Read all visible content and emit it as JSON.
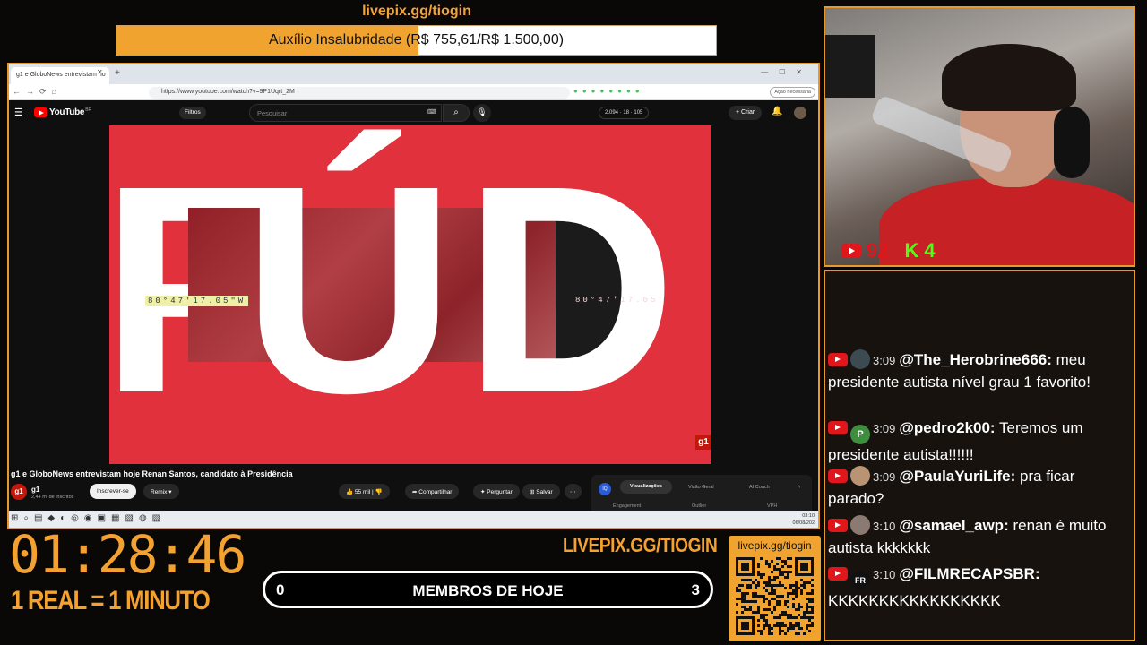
{
  "goal": {
    "url": "livepix.gg/tiogin",
    "text": "Auxílio Insalubridade (R$ 755,61/R$ 1.500,00)",
    "progress": 0.5037
  },
  "browser": {
    "tab_title": "g1 e GloboNews entrevistam ho",
    "url": "https://www.youtube.com/watch?v=9P1Uqrt_2M",
    "ai_button": "Ação necessária"
  },
  "youtube": {
    "logo": "YouTube",
    "country": "BR",
    "filters_label": "Filtros",
    "search_placeholder": "Pesquisar",
    "stats": "2.094 · 18 · 105",
    "create_label": "Criar",
    "video": {
      "letters": [
        "F",
        "Ú",
        "D"
      ],
      "coord_left": "80°47'17.05\"W",
      "coord_right": "80°47'17.05",
      "badge": "g1"
    },
    "title": "g1 e GloboNews entrevistam hoje Renan Santos, candidato à Presidência",
    "channel": {
      "avatar": "g1",
      "name": "g1",
      "subscribers": "2,44 mi de inscritos",
      "subscribe_label": "Inscrever-se",
      "remix_label": "Remix"
    },
    "actions": {
      "likes": "55 mil",
      "share": "Compartilhar",
      "ask": "Perguntar",
      "save": "Salvar"
    },
    "side_panel": {
      "logo": "IQ",
      "tabs": [
        "Visualizações",
        "Visão Geral",
        "AI Coach"
      ],
      "columns": [
        "Engagement",
        "Outlier",
        "VPH"
      ]
    }
  },
  "taskbar": {
    "time": "03:10",
    "date": "06/08/202"
  },
  "webcam": {
    "youtube_viewers": "92",
    "kick_icon": "K",
    "kick_viewers": "4"
  },
  "chat": [
    {
      "time": "3:09",
      "user": "@The_Herobrine666:",
      "text": "meu presidente autista nível grau 1 favorito!",
      "avatar": "",
      "avatar_color": "#3c4a52"
    },
    {
      "time": "3:09",
      "user": "@pedro2k00:",
      "text": "Teremos um presidente autista!!!!!!",
      "avatar": "P",
      "avatar_color": "#3f8d3e"
    },
    {
      "time": "3:09",
      "user": "@PaulaYuriLife:",
      "text": "pra ficar parado?",
      "avatar": "",
      "avatar_color": "#b89474"
    },
    {
      "time": "3:10",
      "user": "@samael_awp:",
      "text": "renan é muito autista kkkkkkk",
      "avatar": "",
      "avatar_color": "#8a7a72"
    },
    {
      "time": "3:10",
      "user": "@FILMRECAPSBR:",
      "text": "KKKKKKKKKKKKKKKKK",
      "avatar": "FR",
      "avatar_color": "#111111"
    }
  ],
  "overlay": {
    "timer": "01:28:46",
    "rate": "1 REAL = 1 MINUTO",
    "livepix_big": "LIVEPIX.GG/TIOGIN",
    "members_left": "0",
    "members_label": "MEMBROS DE HOJE",
    "members_right": "3",
    "qr_url": "livepix.gg/tiogin"
  },
  "colors": {
    "accent": "#f3a130",
    "youtube_red": "#e1161b",
    "kick_green": "#53fc18",
    "video_red": "#e0313c"
  }
}
